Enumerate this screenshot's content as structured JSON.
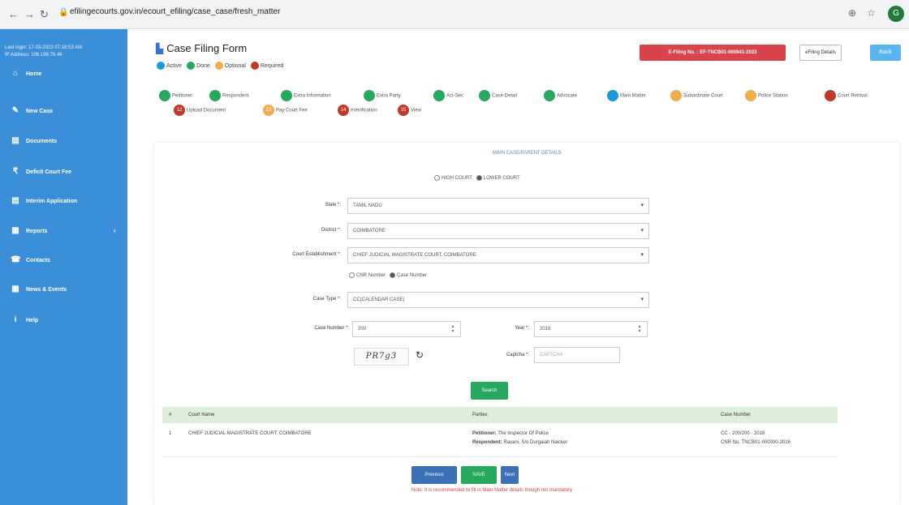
{
  "browser": {
    "url": "efilingecourts.gov.in/ecourt_efiling/case_case/fresh_matter",
    "profile_initial": "G"
  },
  "sidebar": {
    "user_line1": "Last login: 17-03-2023 07:18:53 AM",
    "user_line2": "IP Address: 106.198.76.46",
    "items": [
      {
        "label": "Home",
        "icon": "home-icon",
        "glyph": "⌂"
      },
      {
        "label": "New Case",
        "icon": "new-case-icon",
        "glyph": "✎"
      },
      {
        "label": "Documents",
        "icon": "documents-icon",
        "glyph": "▤"
      },
      {
        "label": "Deficit Court Fee",
        "icon": "court-fee-icon",
        "glyph": "₹"
      },
      {
        "label": "Interim Application",
        "icon": "application-icon",
        "glyph": "▤"
      },
      {
        "label": "Reports",
        "icon": "reports-icon",
        "glyph": "▦"
      },
      {
        "label": "Contacts",
        "icon": "contacts-icon",
        "glyph": "☎"
      },
      {
        "label": "News & Events",
        "icon": "news-icon",
        "glyph": "▦"
      },
      {
        "label": "Help",
        "icon": "help-icon",
        "glyph": "i"
      }
    ]
  },
  "header": {
    "title": "Case Filing Form",
    "legend": [
      {
        "label": "Active",
        "color": "#1a9ad6"
      },
      {
        "label": "Done",
        "color": "#27a85f"
      },
      {
        "label": "Optional",
        "color": "#f0ad4e"
      },
      {
        "label": "Required",
        "color": "#c0392b"
      }
    ],
    "efiling_no": "E-Filing No. : EF-TNCB01-000941-2023",
    "efiling_pdf": "eFiling Details",
    "back": "Back"
  },
  "steps": [
    {
      "label": "Petitioner",
      "num": "",
      "color": "#27a85f"
    },
    {
      "label": "Respondent",
      "num": "",
      "color": "#27a85f"
    },
    {
      "label": "Extra Information",
      "num": "",
      "color": "#27a85f"
    },
    {
      "label": "Extra Party",
      "num": "",
      "color": "#27a85f"
    },
    {
      "label": "Act-Sec",
      "num": "",
      "color": "#27a85f"
    },
    {
      "label": "Case Detail",
      "num": "",
      "color": "#27a85f"
    },
    {
      "label": "Advocate",
      "num": "",
      "color": "#27a85f"
    },
    {
      "label": "Main Matter",
      "num": "",
      "color": "#1a9ad6"
    },
    {
      "label": "Subordinate Court",
      "num": "",
      "color": "#f0ad4e"
    },
    {
      "label": "Police Station",
      "num": "",
      "color": "#f0ad4e"
    },
    {
      "label": "Court Retrival",
      "num": "",
      "color": "#c0392b"
    },
    {
      "label": "Upload Document",
      "num": "12",
      "color": "#c0392b"
    },
    {
      "label": "Pay Court Fee",
      "num": "13",
      "color": "#f0ad4e"
    },
    {
      "label": "eVerification",
      "num": "14",
      "color": "#c0392b"
    },
    {
      "label": "View",
      "num": "15",
      "color": "#c0392b"
    }
  ],
  "panel": {
    "title": "MAIN CASE/PARENT DETAILS",
    "court_high": "HIGH COURT",
    "court_lower": "LOWER COURT",
    "state_label": "State *:",
    "state_value": "TAMIL NADU",
    "district_label": "District *:",
    "district_value": "COIMBATORE",
    "establishment_label": "Court Establishment *:",
    "establishment_value": "CHIEF JUDICIAL MAGISTRATE COURT, COIMBATORE",
    "cnr_label": "CNR Number",
    "casenum_label": "Case Number",
    "casetype_label": "Case Type *:",
    "casetype_value": "CC(CALENDAR CASE)",
    "casenumber_label": "Case Number *:",
    "casenumber_value": "200",
    "year_label": "Year *:",
    "year_value": "2016",
    "captcha_text": "PR7g3",
    "captcha_label": "Captcha *:",
    "captcha_placeholder": "CAPTCHA",
    "search": "Search"
  },
  "table": {
    "headers": [
      "#",
      "Court Name",
      "Parties",
      "Case Number"
    ],
    "rows": [
      {
        "num": "1",
        "court": "CHIEF JUDICIAL MAGISTRATE COURT, COIMBATORE",
        "petitioner_label": "Petitioner:",
        "petitioner": "The Inspector Of Police",
        "respondent_label": "Respondent:",
        "respondent": "Ravani, S/o Durgaiah Naicker",
        "case_no": "CC - 200/200 - 2016",
        "cnr": "CNR No. TNCB01-000000-2016"
      }
    ]
  },
  "footer": {
    "previous": "Previous",
    "save": "SAVE",
    "next": "Next",
    "note": "Note: It is recommended to fill in Main Matter details though not mandatory"
  }
}
